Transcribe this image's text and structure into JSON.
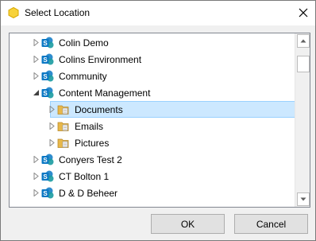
{
  "window": {
    "title": "Select Location",
    "app_icon": "yellow-hexagon-icon",
    "close_icon": "close-icon"
  },
  "tree": {
    "items": [
      {
        "label": "Colin Demo",
        "icon": "sharepoint-icon",
        "level": 1,
        "expanded": false,
        "selected": false
      },
      {
        "label": "Colins Environment",
        "icon": "sharepoint-icon",
        "level": 1,
        "expanded": false,
        "selected": false
      },
      {
        "label": "Community",
        "icon": "sharepoint-icon",
        "level": 1,
        "expanded": false,
        "selected": false
      },
      {
        "label": "Content Management",
        "icon": "sharepoint-icon",
        "level": 1,
        "expanded": true,
        "selected": false
      },
      {
        "label": "Documents",
        "icon": "document-library-icon",
        "level": 2,
        "expanded": false,
        "selected": true
      },
      {
        "label": "Emails",
        "icon": "document-library-icon",
        "level": 2,
        "expanded": false,
        "selected": false
      },
      {
        "label": "Pictures",
        "icon": "document-library-icon",
        "level": 2,
        "expanded": false,
        "selected": false
      },
      {
        "label": "Conyers Test 2",
        "icon": "sharepoint-icon",
        "level": 1,
        "expanded": false,
        "selected": false
      },
      {
        "label": "CT Bolton 1",
        "icon": "sharepoint-icon",
        "level": 1,
        "expanded": false,
        "selected": false
      },
      {
        "label": "D & D Beheer",
        "icon": "sharepoint-icon",
        "level": 1,
        "expanded": false,
        "selected": false
      }
    ]
  },
  "buttons": {
    "ok": "OK",
    "cancel": "Cancel"
  },
  "colors": {
    "sharepoint": "#0b78c4",
    "folder": "#e8b84a",
    "selection": "#cce8ff",
    "selection_border": "#99d1ff"
  }
}
